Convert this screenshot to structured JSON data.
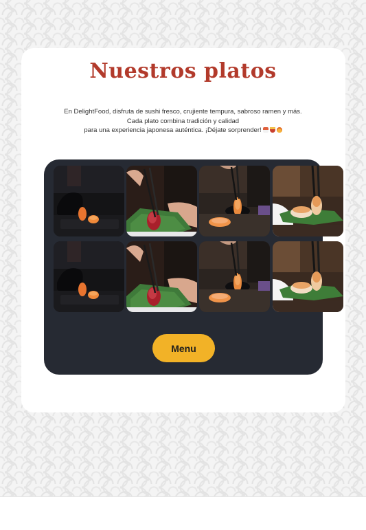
{
  "section": {
    "title": "Nuestros platos",
    "description_lines": [
      "En DelightFood, disfruta de sushi fresco, crujiente tempura, sabroso ramen y más.",
      "Cada plato combina tradición y calidad",
      "para una experiencia japonesa auténtica. ¡Déjate sorprender!"
    ],
    "description_emojis": [
      "sushi-icon",
      "ramen-icon",
      "fire-icon"
    ]
  },
  "gallery": {
    "rows": 2,
    "images": [
      "gloved-hand-with-salmon-nigiri-photo",
      "chopsticks-with-tuna-on-green-plate-photo",
      "chopsticks-with-salmon-nigiri-photo",
      "salmon-nigiri-on-leaf-plate-photo"
    ]
  },
  "menu_button": {
    "label": "Menu"
  },
  "colors": {
    "title": "#b23a2b",
    "panel": "#262a33",
    "button": "#f2b227",
    "text": "#333333"
  }
}
